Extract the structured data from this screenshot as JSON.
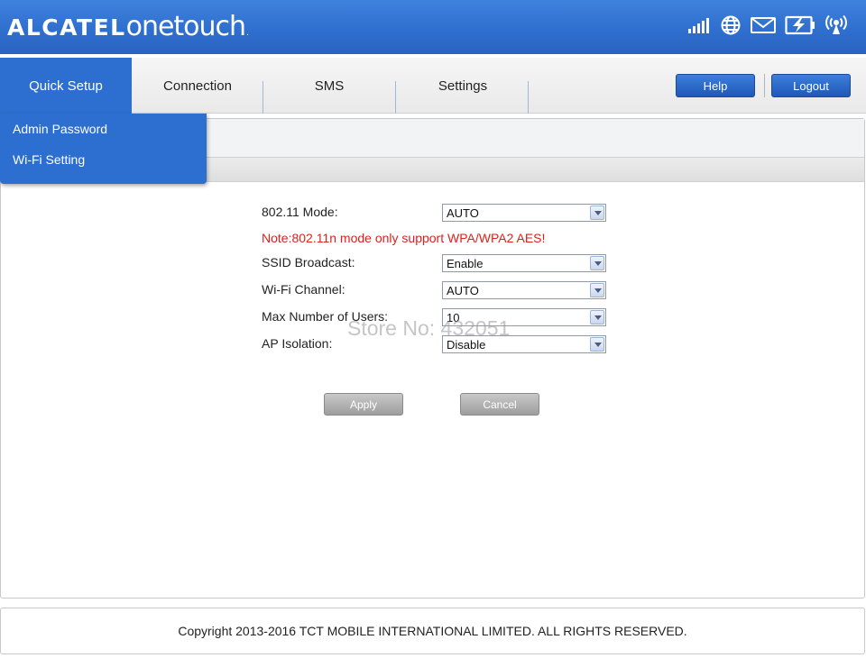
{
  "header": {
    "brand_bold": "ALCATEL",
    "brand_light": "onetouch",
    "brand_mark": ".",
    "status_icons": [
      "signal-icon",
      "globe-icon",
      "mail-icon",
      "battery-charging-icon",
      "wifi-icon"
    ]
  },
  "nav": {
    "tabs": [
      {
        "label": "Quick Setup",
        "active": true
      },
      {
        "label": "Connection",
        "active": false
      },
      {
        "label": "SMS",
        "active": false
      },
      {
        "label": "Settings",
        "active": false
      }
    ],
    "help_label": "Help",
    "logout_label": "Logout"
  },
  "dropdown": {
    "items": [
      "Admin Password",
      "Wi-Fi Setting"
    ]
  },
  "form": {
    "mode_label": "802.11 Mode:",
    "mode_value": "AUTO",
    "note": "Note:802.11n mode only support WPA/WPA2 AES!",
    "ssid_label": "SSID Broadcast:",
    "ssid_value": "Enable",
    "channel_label": "Wi-Fi Channel:",
    "channel_value": "AUTO",
    "max_users_label": "Max Number of Users:",
    "max_users_value": "10",
    "ap_label": "AP Isolation:",
    "ap_value": "Disable",
    "apply_label": "Apply",
    "cancel_label": "Cancel"
  },
  "watermark": "Store No: 432051",
  "footer": {
    "copyright": "Copyright 2013-2016 TCT MOBILE INTERNATIONAL LIMITED. ALL RIGHTS RESERVED."
  },
  "colors": {
    "header_blue": "#2f6fcf",
    "active_tab": "#2c6fd0",
    "note_red": "#e0201a"
  }
}
